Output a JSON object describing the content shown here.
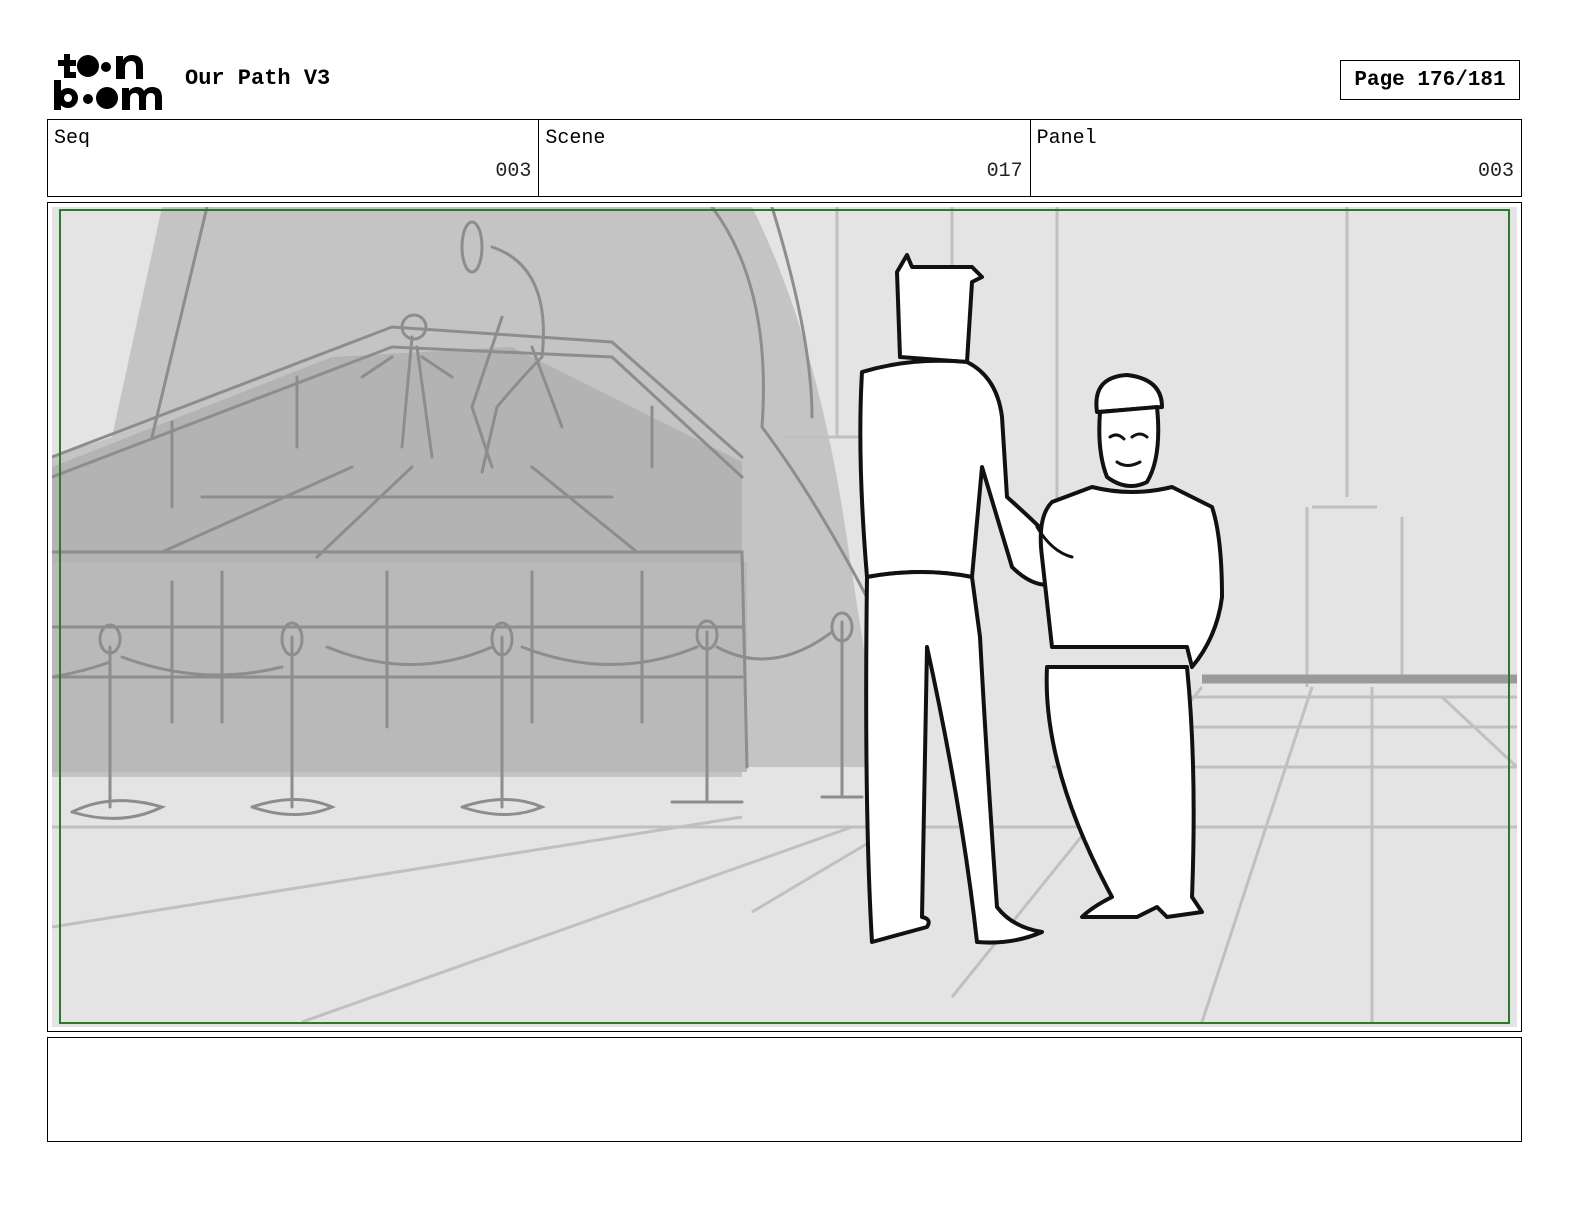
{
  "header": {
    "logo_text": "toon boom",
    "title": "Our Path V3",
    "page_label": "Page 176/181"
  },
  "info": {
    "seq_label": "Seq",
    "seq_value": "003",
    "scene_label": "Scene",
    "scene_value": "017",
    "panel_label": "Panel",
    "panel_value": "003"
  },
  "panel": {
    "icon": "storyboard-sketch",
    "safe_frame_color": "#2a7a2a"
  },
  "notes": {
    "text": ""
  }
}
